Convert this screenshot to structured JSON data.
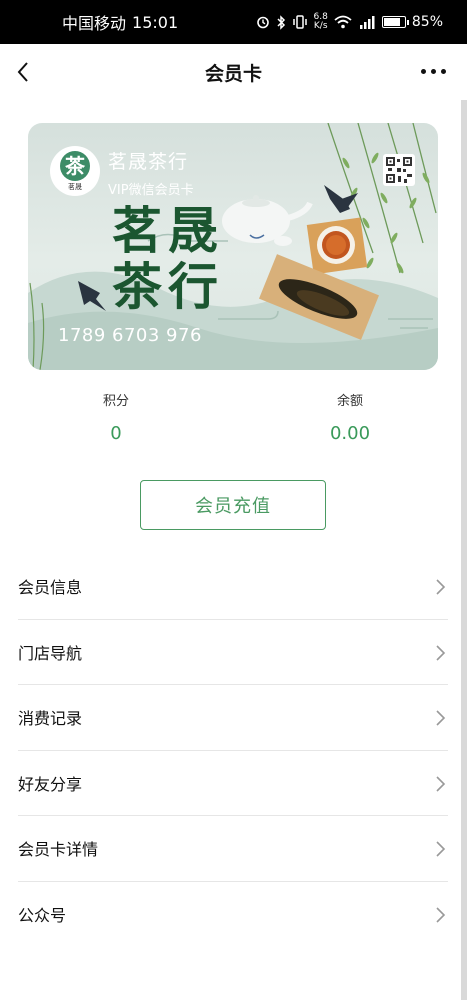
{
  "status_bar": {
    "carrier": "中国移动",
    "time": "15:01",
    "net_speed_value": "6.8",
    "net_speed_unit": "K/s",
    "battery_percent": "85%",
    "battery_level": 0.85
  },
  "nav": {
    "title": "会员卡",
    "back_icon": "chevron-left-icon",
    "more_icon": "more-dots-icon"
  },
  "card": {
    "logo_glyph": "茶",
    "logo_caption": "茗晟",
    "store_name": "茗晟茶行",
    "card_type": "VIP微信会员卡",
    "brand_line1": "茗晟",
    "brand_line2": "茶行",
    "card_number": "1789 6703 976",
    "qr_icon": "qr-code-icon"
  },
  "stats": {
    "points_label": "积分",
    "points_value": "0",
    "balance_label": "余额",
    "balance_value": "0.00"
  },
  "recharge_button": "会员充值",
  "menu": [
    {
      "label": "会员信息"
    },
    {
      "label": "门店导航"
    },
    {
      "label": "消费记录"
    },
    {
      "label": "好友分享"
    },
    {
      "label": "会员卡详情"
    },
    {
      "label": "公众号"
    }
  ],
  "colors": {
    "accent": "#4a9a62",
    "brand_dark": "#1b5630",
    "status_bar_bg": "#000000"
  }
}
